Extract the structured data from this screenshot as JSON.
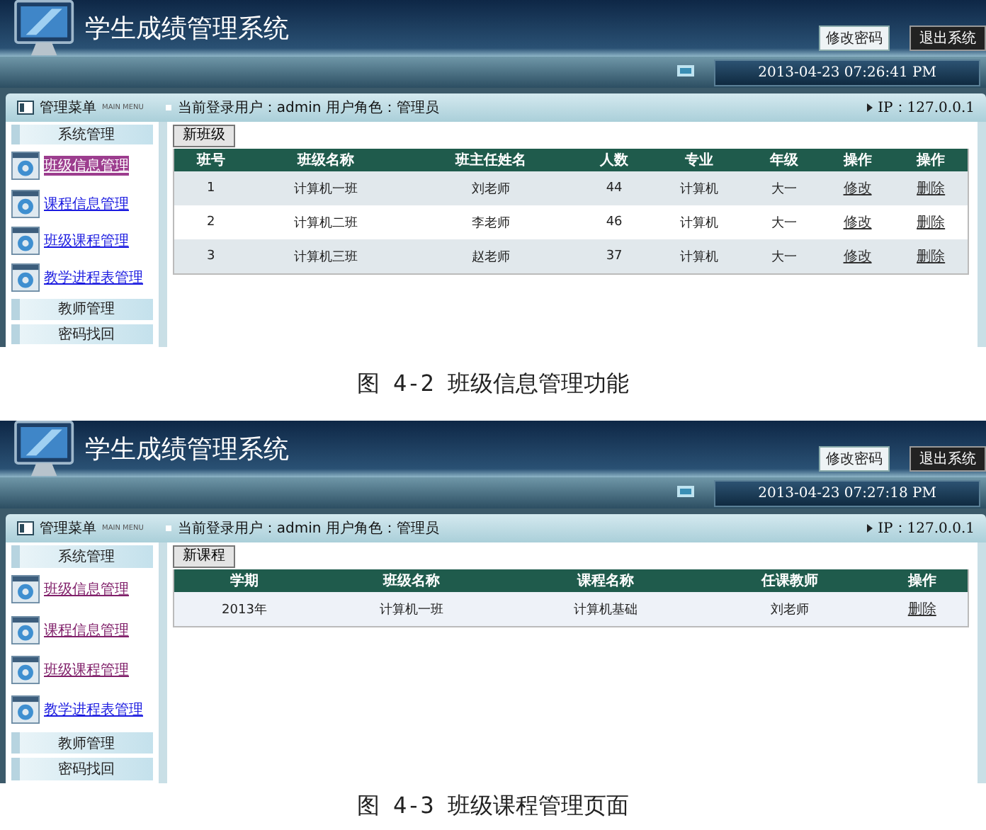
{
  "figures": [
    {
      "app": {
        "title": "学生成绩管理系统",
        "change_password": "修改密码",
        "logout": "退出系统",
        "datetime": "2013-04-23 07:26:41 PM",
        "menu_title": "管理菜单",
        "menu_subtitle": "MAIN MENU",
        "user_info": "当前登录用户：admin 用户角色：管理员",
        "ip": "IP：127.0.0.1",
        "menu": [
          {
            "kind": "section",
            "label": "系统管理"
          },
          {
            "kind": "link",
            "label": "班级信息管理",
            "selected": true,
            "visited": false
          },
          {
            "kind": "link",
            "label": "课程信息管理",
            "selected": false,
            "visited": false
          },
          {
            "kind": "link",
            "label": "班级课程管理",
            "selected": false,
            "visited": false
          },
          {
            "kind": "link",
            "label": "教学进程表管理",
            "selected": false,
            "visited": false
          },
          {
            "kind": "section",
            "label": "教师管理"
          },
          {
            "kind": "section",
            "label": "密码找回"
          }
        ],
        "add_button": "新班级",
        "table": {
          "columns": [
            {
              "label": "班号",
              "kind": "text"
            },
            {
              "label": "班级名称",
              "kind": "text"
            },
            {
              "label": "班主任姓名",
              "kind": "text"
            },
            {
              "label": "人数",
              "kind": "text"
            },
            {
              "label": "专业",
              "kind": "text"
            },
            {
              "label": "年级",
              "kind": "text"
            },
            {
              "label": "操作",
              "kind": "link"
            },
            {
              "label": "操作",
              "kind": "link"
            }
          ],
          "rows": [
            [
              "1",
              "计算机一班",
              "刘老师",
              "44",
              "计算机",
              "大一",
              "修改",
              "删除"
            ],
            [
              "2",
              "计算机二班",
              "李老师",
              "46",
              "计算机",
              "大一",
              "修改",
              "删除"
            ],
            [
              "3",
              "计算机三班",
              "赵老师",
              "37",
              "计算机",
              "大一",
              "修改",
              "删除"
            ]
          ]
        }
      },
      "caption": "图 4-2 班级信息管理功能"
    },
    {
      "app": {
        "title": "学生成绩管理系统",
        "change_password": "修改密码",
        "logout": "退出系统",
        "datetime": "2013-04-23 07:27:18 PM",
        "menu_title": "管理菜单",
        "menu_subtitle": "MAIN MENU",
        "user_info": "当前登录用户：admin 用户角色：管理员",
        "ip": "IP：127.0.0.1",
        "menu": [
          {
            "kind": "section",
            "label": "系统管理"
          },
          {
            "kind": "link",
            "label": "班级信息管理",
            "selected": false,
            "visited": true
          },
          {
            "kind": "link",
            "label": "课程信息管理",
            "selected": false,
            "visited": true
          },
          {
            "kind": "link",
            "label": "班级课程管理",
            "selected": false,
            "visited": true
          },
          {
            "kind": "link",
            "label": "教学进程表管理",
            "selected": false,
            "visited": false
          },
          {
            "kind": "section",
            "label": "教师管理"
          },
          {
            "kind": "section",
            "label": "密码找回"
          }
        ],
        "add_button": "新课程",
        "table": {
          "columns": [
            {
              "label": "学期",
              "kind": "text"
            },
            {
              "label": "班级名称",
              "kind": "text"
            },
            {
              "label": "课程名称",
              "kind": "text"
            },
            {
              "label": "任课教师",
              "kind": "text"
            },
            {
              "label": "操作",
              "kind": "link"
            }
          ],
          "rows": [
            [
              "2013年",
              "计算机一班",
              "计算机基础",
              "刘老师",
              "删除"
            ]
          ]
        }
      },
      "caption": "图 4-3 班级课程管理页面"
    }
  ]
}
